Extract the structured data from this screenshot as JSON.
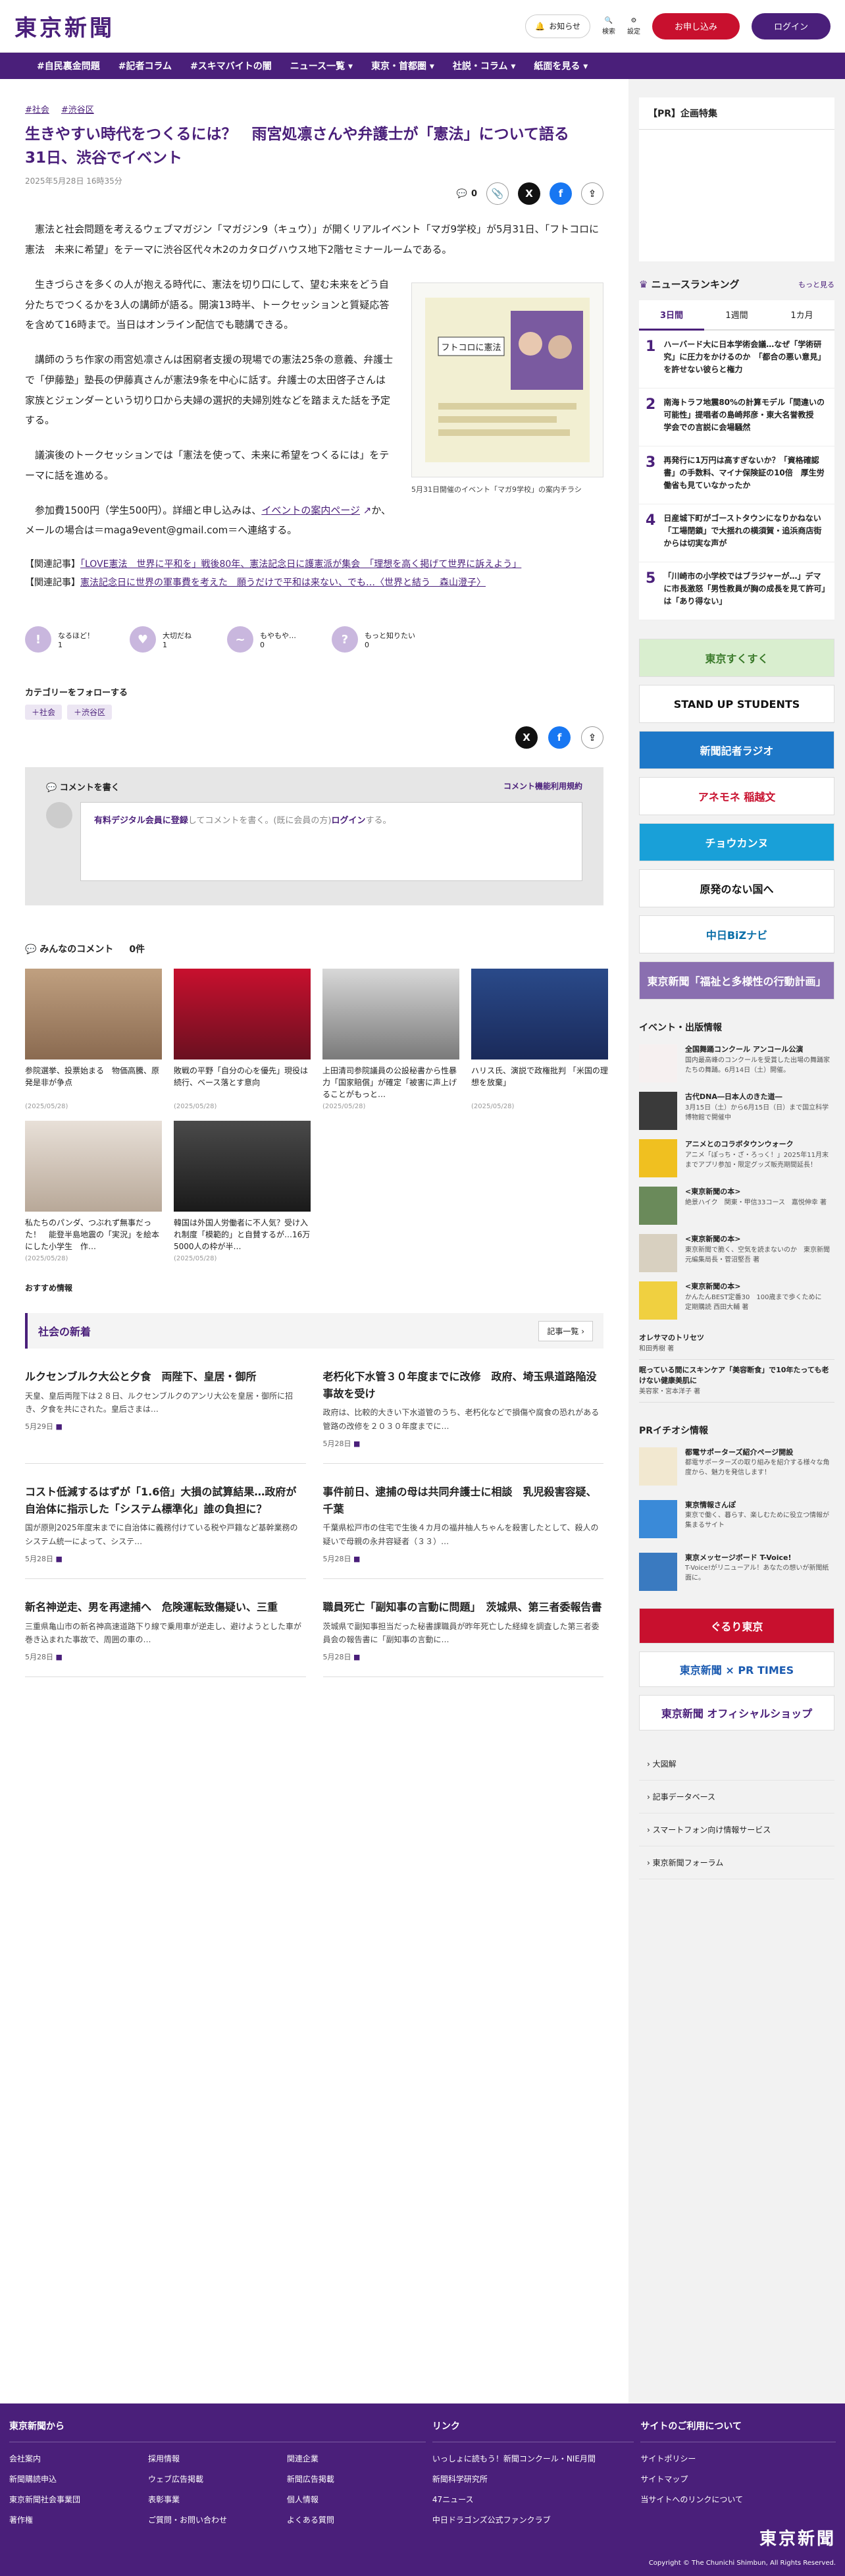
{
  "header": {
    "logo": "東京新聞",
    "notice": "お知らせ",
    "search": "検索",
    "settings": "設定",
    "apply": "お申し込み",
    "login": "ログイン"
  },
  "nav": [
    "#自民裏金問題",
    "#記者コラム",
    "#スキマバイトの闇",
    "ニュース一覧 ▾",
    "東京・首都圏 ▾",
    "社説・コラム ▾",
    "紙面を見る ▾"
  ],
  "article": {
    "tags": [
      "#社会",
      "#渋谷区"
    ],
    "title": "生きやすい時代をつくるには？　雨宮処凛さんや弁護士が「憲法」について語る　31日、渋谷でイベント",
    "date": "2025年5月28日 16時35分",
    "comment_count": "0",
    "paragraphs": [
      "憲法と社会問題を考えるウェブマガジン「マガジン9（キュウ）」が開くリアルイベント「マガ9学校」が5月31日、「フトコロに憲法　未来に希望」をテーマに渋谷区代々木2のカタログハウス地下2階セミナールームである。",
      "生きづらさを多くの人が抱える時代に、憲法を切り口にして、望む未来をどう自分たちでつくるかを3人の講師が語る。開演13時半、トークセッションと質疑応答を含めて16時まで。当日はオンライン配信でも聴講できる。",
      "講師のうち作家の雨宮処凛さんは困窮者支援の現場での憲法25条の意義、弁護士で「伊藤塾」塾長の伊藤真さんが憲法9条を中心に話す。弁護士の太田啓子さんは家族とジェンダーという切り口から夫婦の選択的夫婦別姓などを踏まえた話を予定する。",
      "議演後のトークセッションでは「憲法を使って、未来に希望をつくるには」をテーマに話を進める。"
    ],
    "fee_text": "参加費1500円（学生500円）。詳細と申し込みは、",
    "fee_link": "イベントの案内ページ",
    "fee_tail": "か、メールの場合は＝maga9event@gmail.com＝へ連絡する。",
    "figure_caption": "5月31日開催のイベント「マガ9学校」の案内チラシ",
    "figure_title": "フトコロに憲法",
    "related": [
      {
        "label": "【関連記事】",
        "text": "「LOVE憲法　世界に平和を」戦後80年、憲法記念日に護憲派が集会　「理想を高く掲げて世界に訴えよう」"
      },
      {
        "label": "【関連記事】",
        "text": "憲法記念日に世界の軍事費を考えた　願うだけで平和は来ない、でも…〈世界と結う　森山澄子〉"
      }
    ]
  },
  "reactions": [
    {
      "label": "なるほど！",
      "count": "1",
      "icon": "!"
    },
    {
      "label": "大切だね",
      "count": "1",
      "icon": "♥"
    },
    {
      "label": "もやもや…",
      "count": "0",
      "icon": "~"
    },
    {
      "label": "もっと知りたい",
      "count": "0",
      "icon": "?"
    }
  ],
  "follow": {
    "title": "カテゴリーをフォローする",
    "tags": [
      "＋社会",
      "＋渋谷区"
    ]
  },
  "comment_box": {
    "title": "コメントを書く",
    "rules": "コメント機能利用規約",
    "member_link": "有料デジタル会員に登録",
    "prompt_mid": "してコメントを書く。(既に会員の方)",
    "login_link": "ログイン",
    "prompt_end": "する。"
  },
  "comments": {
    "title": "みんなのコメント",
    "count": "0件"
  },
  "cards": [
    {
      "text": "参院選挙、投票始まる　物価高騰、原発是非が争点",
      "date": "(2025/05/28)"
    },
    {
      "text": "敗戦の平野「自分の心を優先」現役は続行、ベース落とす意向",
      "date": "(2025/05/28)"
    },
    {
      "text": "上田清司参院議員の公設秘書から性暴力「国家賠償」が確定「被害に声上げることがもっと…",
      "date": "(2025/05/28)"
    },
    {
      "text": "ハリス氏、演説で政権批判 「米国の理想を放棄」",
      "date": "(2025/05/28)"
    },
    {
      "text": "私たちのパンダ、つぶれず無事だった！　能登半島地震の「実況」を絵本にした小学生　作…",
      "date": "(2025/05/28)"
    },
    {
      "text": "韓国は外国人労働者に不人気？受け入れ制度「模範的」と自賛するが…16万5000人の枠が半…",
      "date": "(2025/05/28)"
    }
  ],
  "recommend": "おすすめ情報",
  "society": {
    "title": "社会の新着",
    "more": "記事一覧",
    "news": [
      {
        "h": "ルクセンブルク大公と夕食　両陛下、皇居・御所",
        "s": "天皇、皇后両陛下は２８日、ルクセンブルクのアンリ大公を皇居・御所に招き、夕食を共にされた。皇后さまは…",
        "d": "5月29日"
      },
      {
        "h": "老朽化下水管３０年度までに改修　政府、埼玉県道路陥没事故を受け",
        "s": "政府は、比較的大きい下水道管のうち、老朽化などで損傷や腐食の恐れがある管路の改修を２０３０年度までに…",
        "d": "5月28日"
      },
      {
        "h": "コスト低減するはずが「1.6倍」大損の試算結果…政府が自治体に指示した「システム標準化」誰の負担に？",
        "s": "国が原則2025年度末までに自治体に義務付けている税や戸籍など基幹業務のシステム統一によって、システ…",
        "d": "5月28日"
      },
      {
        "h": "事件前日、逮捕の母は共同弁護士に相談　乳児殺害容疑、千葉",
        "s": "千葉県松戸市の住宅で生後４カ月の福井柚人ちゃんを殺害したとして、殺人の疑いで母親の永井容疑者（３３）…",
        "d": "5月28日"
      },
      {
        "h": "新名神逆走、男を再逮捕へ　危険運転致傷疑い、三重",
        "s": "三重県亀山市の新名神高速道路下り線で乗用車が逆走し、避けようとした車が巻き込まれた事故で、周囲の車の…",
        "d": "5月28日"
      },
      {
        "h": "職員死亡「副知事の言動に問題」　茨城県、第三者委報告書",
        "s": "茨城県で副知事担当だった秘書課職員が昨年死亡した経緯を調査した第三者委員会の報告書に「副知事の言動に…",
        "d": "5月28日"
      }
    ]
  },
  "sidebar": {
    "pr_title": "【PR】企画特集",
    "ranking_title": "ニュースランキング",
    "ranking_more": "もっと見る",
    "tabs": [
      "3日間",
      "1週間",
      "1カ月"
    ],
    "ranking": [
      {
        "n": "1",
        "t": "ハーバード大に日本学術会議…なぜ「学術研究」に圧力をかけるのか　「都合の悪い意見」を許せない彼らと権力"
      },
      {
        "n": "2",
        "t": "南海トラフ地震80%の計算モデル「間違いの可能性」提唱者の島崎邦彦・東大名誉教授　学会での言説に会場騒然"
      },
      {
        "n": "3",
        "t": "再発行に1万円は高すぎないか？「資格確認書」の手数料、マイナ保険証の10倍　厚生労働省も見ていなかったか"
      },
      {
        "n": "4",
        "t": "日産城下町がゴーストタウンになりかねない「工場閉鎖」で大揺れの横須賀・追浜商店街からは切実な声が"
      },
      {
        "n": "5",
        "t": "「川崎市の小学校ではブラジャーが…」デマに市長激怒「男性教員が胸の成長を見て許可」は「あり得ない」"
      }
    ],
    "banners": [
      {
        "text": "東京すくすく",
        "bg": "#d9eecf",
        "fg": "#3a7a2a"
      },
      {
        "text": "STAND UP STUDENTS",
        "bg": "#ffffff",
        "fg": "#111111"
      },
      {
        "text": "新聞記者ラジオ",
        "bg": "#1e78c8",
        "fg": "#ffffff"
      },
      {
        "text": "アネモネ 稲越文",
        "bg": "#ffffff",
        "fg": "#c8102e"
      },
      {
        "text": "チョウカンヌ",
        "bg": "#19a0d8",
        "fg": "#ffffff"
      },
      {
        "text": "原発のない国へ",
        "bg": "#ffffff",
        "fg": "#111111"
      },
      {
        "text": "中日BiZナビ",
        "bg": "#ffffff",
        "fg": "#0a6ea8"
      },
      {
        "text": "東京新聞「福祉と多様性の行動計画」",
        "bg": "#8a6fb0",
        "fg": "#ffffff"
      }
    ],
    "events_title": "イベント・出版情報",
    "events": [
      {
        "t": "全国舞踊コンクール アンコール公演",
        "s": "国内最高峰のコンクールを受賞した出場の舞踊家たちの舞踊。6月14日（土）開催。",
        "bg": "#f6f0f0"
      },
      {
        "t": "古代DNA―日本人のきた道―",
        "s": "3月15日（土）から6月15日（日）まで国立科学博物館で開催中",
        "bg": "#3a3a3a"
      },
      {
        "t": "アニメとのコラボタウンウォーク",
        "s": "アニメ「ぽっち・ざ・ろっく！」2025年11月末までアプリ参加・限定グッズ販売期間延長！",
        "bg": "#f0c020"
      },
      {
        "t": "<東京新聞の本>",
        "s": "絶景ハイク　関東・甲信33コース　嘉悦伸幸 著",
        "bg": "#6a8a5a"
      },
      {
        "t": "<東京新聞の本>",
        "s": "東京新聞で脆く、空気を読まないのか　東京新聞元編集局長・菅沼堅吾 著",
        "bg": "#d8d0c0"
      },
      {
        "t": "<東京新聞の本>",
        "s": "かんたんBEST定番30　100歳まで歩くために　定期購読 西田大輔 著",
        "bg": "#f0d040"
      }
    ],
    "books_extra": [
      {
        "t": "オレサマのトリセツ",
        "s": "和田秀樹 著"
      },
      {
        "t": "眠っている間にスキンケア「美容断食」で10年たっても老けない健康美肌に",
        "s": "美容家・宮本洋子 著"
      }
    ],
    "pr_info_title": "PRイチオシ情報",
    "pr_info": [
      {
        "t": "都電サポーターズ紹介ページ開設",
        "s": "都電サポーターズの取り組みを紹介する様々な角度から、魅力を発信します！",
        "bg": "#f2e8d0"
      },
      {
        "t": "東京情報さんぽ",
        "s": "東京で働く、暮らす、楽しむために役立つ情報が集まるサイト",
        "bg": "#3a8ad8"
      },
      {
        "t": "東京メッセージボード T-Voice!",
        "s": "T-Voice!がリニューアル！あなたの想いが新聞紙面に。",
        "bg": "#3a7ac0"
      }
    ],
    "shop_banners": [
      {
        "text": "ぐるり東京",
        "bg": "#c8102e",
        "fg": "#ffffff"
      },
      {
        "text": "東京新聞 × PR TIMES",
        "bg": "#ffffff",
        "fg": "#1a5ab0"
      },
      {
        "text": "東京新聞 オフィシャルショップ",
        "bg": "#ffffff",
        "fg": "#4a1f7a"
      }
    ],
    "links": [
      "大図解",
      "記事データベース",
      "スマートフォン向け情報サービス",
      "東京新聞フォーラム"
    ]
  },
  "footer": {
    "col1_title": "東京新聞から",
    "col1_items": [
      "会社案内",
      "採用情報",
      "関連企業",
      "新聞購読申込",
      "ウェブ広告掲載",
      "新聞広告掲載",
      "東京新聞社会事業団",
      "表彰事業",
      "個人情報",
      "著作権",
      "ご質問・お問い合わせ",
      "よくある質問"
    ],
    "col2_title": "リンク",
    "col2_items": [
      "いっしょに読もう！新聞コンクール・NIE月間",
      "新聞科学研究所",
      "47ニュース",
      "中日ドラゴンズ公式ファンクラブ"
    ],
    "col3_title": "サイトのご利用について",
    "col3_items": [
      "サイトポリシー",
      "サイトマップ",
      "当サイトへのリンクについて"
    ],
    "logo": "東京新聞",
    "copyright": "Copyright © The Chunichi Shimbun, All Rights Reserved."
  }
}
